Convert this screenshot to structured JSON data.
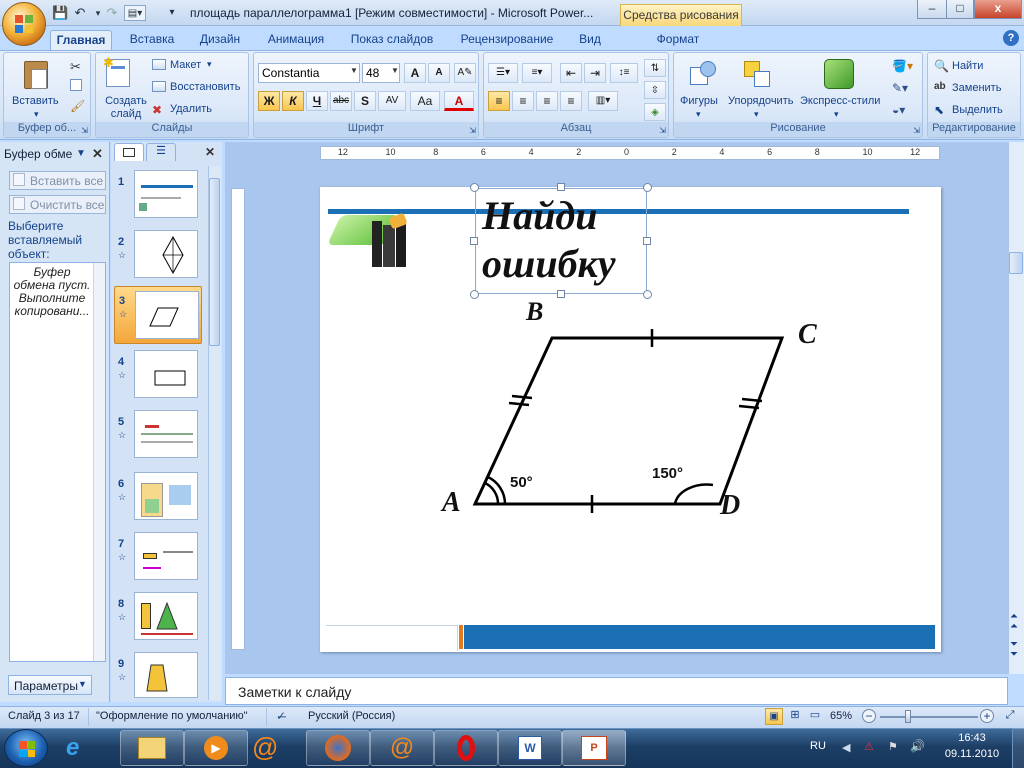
{
  "window": {
    "title": "площадь параллелограмма1 [Режим совместимости] - Microsoft Power...",
    "contextual_tab": "Средства рисования",
    "controls": {
      "minimize": "–",
      "maximize": "□",
      "close": "x"
    }
  },
  "tabs": [
    "Главная",
    "Вставка",
    "Дизайн",
    "Анимация",
    "Показ слайдов",
    "Рецензирование",
    "Вид",
    "Формат"
  ],
  "ribbon": {
    "clipboard": {
      "paste": "Вставить",
      "group_label": "Буфер об..."
    },
    "slides": {
      "new_slide": "Создать слайд",
      "layout": "Макет",
      "reset": "Восстановить",
      "delete": "Удалить",
      "group_label": "Слайды"
    },
    "font": {
      "font_name": "Constantia",
      "font_size": "48",
      "bold": "Ж",
      "italic": "К",
      "underline": "Ч",
      "strike": "abc",
      "shadow": "S",
      "spacing": "AV",
      "case": "Aa",
      "color": "A",
      "grow": "A",
      "shrink": "A",
      "group_label": "Шрифт"
    },
    "paragraph": {
      "group_label": "Абзац"
    },
    "drawing": {
      "shapes": "Фигуры",
      "arrange": "Упорядочить",
      "quick_styles": "Экспресс-стили",
      "group_label": "Рисование"
    },
    "editing": {
      "find": "Найти",
      "replace": "Заменить",
      "select": "Выделить",
      "group_label": "Редактирование"
    }
  },
  "clipboard_pane": {
    "title": "Буфер обме",
    "paste_all": "Вставить все",
    "clear_all": "Очистить все",
    "prompt": "Выберите вставляемый объект:",
    "empty_msg": "Буфер обмена пуст. Выполните копировани...",
    "options": "Параметры"
  },
  "slide_thumbs": [
    {
      "num": "1"
    },
    {
      "num": "2"
    },
    {
      "num": "3"
    },
    {
      "num": "4"
    },
    {
      "num": "5"
    },
    {
      "num": "6"
    },
    {
      "num": "7"
    },
    {
      "num": "8"
    },
    {
      "num": "9"
    }
  ],
  "ruler": {
    "labels": [
      "12",
      "10",
      "8",
      "6",
      "4",
      "2",
      "0",
      "2",
      "4",
      "6",
      "8",
      "10",
      "12"
    ]
  },
  "slide": {
    "title_line1": "Найди",
    "title_line2": "ошибку",
    "vertex_a": "A",
    "vertex_b": "B",
    "vertex_c": "C",
    "vertex_d": "D",
    "angle_a": "50°",
    "angle_d": "150°"
  },
  "notes_placeholder": "Заметки к слайду",
  "status": {
    "slide_info": "Слайд 3 из 17",
    "theme": "\"Оформление по умолчанию\"",
    "language": "Русский (Россия)",
    "zoom": "65%"
  },
  "taskbar": {
    "lang": "RU",
    "time": "16:43",
    "date": "09.11.2010"
  },
  "colors": {
    "accent_blue": "#1a6fb5",
    "accent_orange": "#e07a1f",
    "ribbon_bg": "#dae7f8"
  }
}
